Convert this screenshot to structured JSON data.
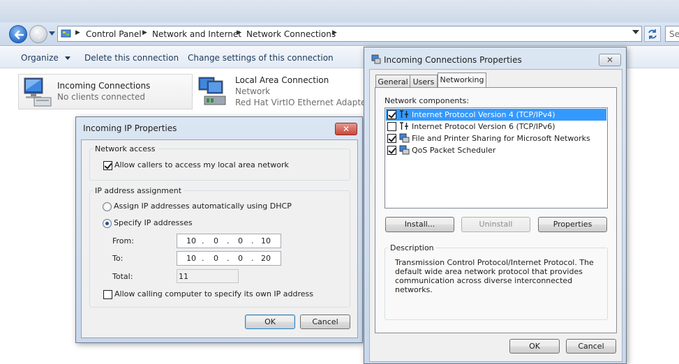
{
  "explorer": {
    "breadcrumb": [
      "Control Panel",
      "Network and Internet",
      "Network Connections"
    ],
    "search_placeholder": "Se",
    "commands": {
      "organize": "Organize",
      "delete": "Delete this connection",
      "change_settings": "Change settings of this connection"
    },
    "connections": [
      {
        "name": "Incoming Connections",
        "status": "No clients connected"
      },
      {
        "name": "Local Area Connection",
        "status": "Network",
        "adapter": "Red Hat VirtIO Ethernet Adapter"
      }
    ]
  },
  "incoming_ip_dialog": {
    "title": "Incoming IP Properties",
    "network_access": {
      "group_label": "Network access",
      "allow_callers_label": "Allow callers to access my local area network",
      "allow_callers_checked": true
    },
    "ip_assignment": {
      "group_label": "IP address assignment",
      "dhcp_label": "Assign IP addresses automatically using DHCP",
      "specify_label": "Specify IP addresses",
      "selected": "specify",
      "from_label": "From:",
      "from_octets": [
        "10",
        "0",
        "0",
        "10"
      ],
      "to_label": "To:",
      "to_octets": [
        "10",
        "0",
        "0",
        "20"
      ],
      "total_label": "Total:",
      "total_value": "11",
      "allow_own_ip_label": "Allow calling computer to specify its own IP address",
      "allow_own_ip_checked": false
    },
    "ok_label": "OK",
    "cancel_label": "Cancel"
  },
  "incoming_props_dialog": {
    "title": "Incoming Connections Properties",
    "tabs": [
      "General",
      "Users",
      "Networking"
    ],
    "active_tab": "Networking",
    "components_label": "Network components:",
    "components": [
      {
        "label": "Internet Protocol Version 4 (TCP/IPv4)",
        "checked": true,
        "selected": true,
        "icon": "protocol-icon"
      },
      {
        "label": "Internet Protocol Version 6 (TCP/IPv6)",
        "checked": false,
        "selected": false,
        "icon": "protocol-icon"
      },
      {
        "label": "File and Printer Sharing for Microsoft Networks",
        "checked": true,
        "selected": false,
        "icon": "service-icon"
      },
      {
        "label": "QoS Packet Scheduler",
        "checked": true,
        "selected": false,
        "icon": "service-icon"
      }
    ],
    "install_label": "Install...",
    "uninstall_label": "Uninstall",
    "properties_label": "Properties",
    "description_label": "Description",
    "description_text": "Transmission Control Protocol/Internet Protocol. The default wide area network protocol that provides communication across diverse interconnected networks.",
    "ok_label": "OK",
    "cancel_label": "Cancel"
  },
  "colors": {
    "selection": "#3399ff",
    "close_button": "#c7483b",
    "link_text": "#1e395b"
  }
}
